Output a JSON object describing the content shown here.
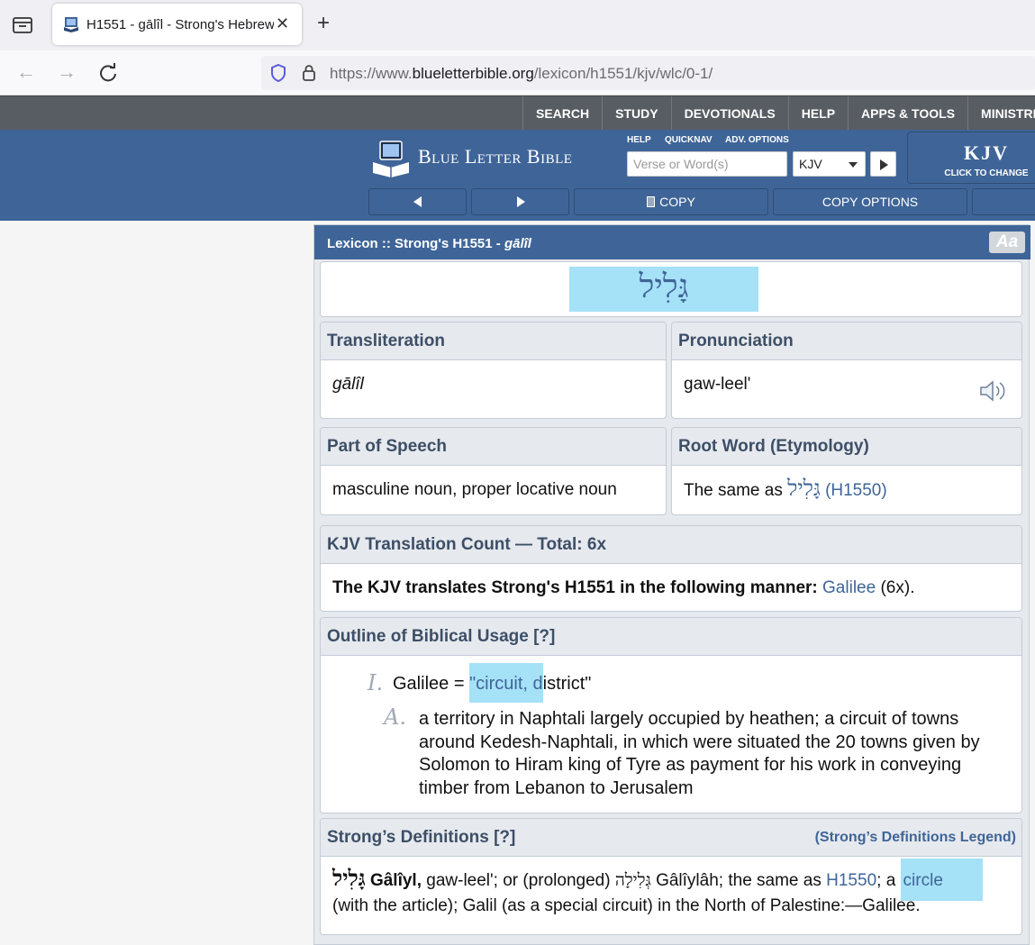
{
  "browser": {
    "tab_title": "H1551 - gālîl - Strong's Hebrew Lexicon (KJV)",
    "url_prefix": "https://www.",
    "url_domain": "blueletterbible.org",
    "url_path": "/lexicon/h1551/kjv/wlc/0-1/"
  },
  "menu": {
    "items": [
      "SEARCH",
      "STUDY",
      "DEVOTIONALS",
      "HELP",
      "APPS & TOOLS",
      "MINISTRIES"
    ]
  },
  "header": {
    "logo_text": "Blue Letter Bible",
    "help_link": "HELP",
    "quicknav_link": "QUICKNAV",
    "adv_options_link": "ADV. OPTIONS",
    "search_placeholder": "Verse or Word(s)",
    "version_selected": "KJV",
    "kjv_label": "KJV",
    "kjv_sub": "CLICK TO CHANGE",
    "copy_label": "COPY",
    "copy_options_label": "COPY OPTIONS"
  },
  "lexicon": {
    "title_prefix": "Lexicon :: Strong's H1551 - ",
    "title_word": "gālîl",
    "aa_label": "Aa",
    "hebrew_word": "גָּלִיל",
    "transliteration_head": "Transliteration",
    "transliteration": "gālîl",
    "pronunciation_head": "Pronunciation",
    "pronunciation": "gaw-leel'",
    "pos_head": "Part of Speech",
    "pos": "masculine noun, proper locative noun",
    "root_head": "Root Word (Etymology)",
    "root_prefix": "The same as ",
    "root_hebrew": "גָּלִיל",
    "root_link": "(H1550)",
    "count_head": "KJV Translation Count — Total: 6x",
    "count_text": "The KJV translates Strong's H1551 in the following manner:",
    "count_link": "Galilee",
    "count_suffix": "(6x).",
    "outline_head": "Outline of Biblical Usage",
    "outline_help": "[?]",
    "outline_1_num": "I.",
    "outline_1_prefix": "Galilee = ",
    "outline_1_hl": "\"circuit, d",
    "outline_1_rest": "istrict\"",
    "outline_a_num": "A.",
    "outline_a_text": "a territory in Naphtali largely occupied by heathen; a circuit of towns around Kedesh-Naphtali, in which were situated the 20 towns given by Solomon to Hiram king of Tyre as payment for his work in conveying timber from Lebanon to Jerusalem",
    "strongs_head": "Strong’s Definitions",
    "strongs_help": "[?]",
    "strongs_legend": "(Strong’s Definitions Legend)",
    "strongs_hebrew": "גָּלִיל",
    "strongs_word": "Gâlîyl,",
    "strongs_t1": " gaw-leel'; or (prolonged) ",
    "strongs_hebrew2": "גְּלִילָה",
    "strongs_t2": " Gâlîylâh; the same as ",
    "strongs_link": "H1550",
    "strongs_t3": "; a ",
    "strongs_circle": "circle",
    "strongs_line2": "(with the article); Galil (as a special circuit) in the North of Palestine:—Galilee."
  }
}
